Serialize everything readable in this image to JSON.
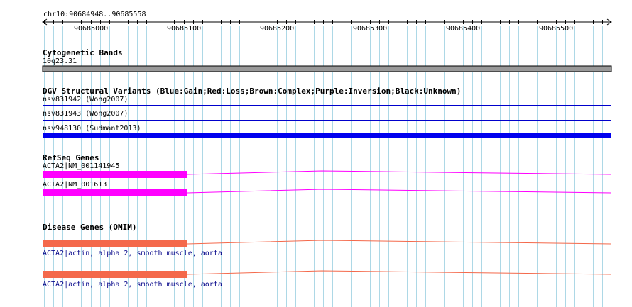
{
  "ruler": {
    "region": "chr10:90684948..90685558",
    "ticks": [
      "90685000",
      "90685100",
      "90685200",
      "90685300",
      "90685400",
      "90685500"
    ]
  },
  "tracks": {
    "cytoband": {
      "title": "Cytogenetic Bands",
      "band": "10q23.31"
    },
    "dgv": {
      "title": "DGV Structural Variants (Blue:Gain;Red:Loss;Brown:Complex;Purple:Inversion;Black:Unknown)",
      "items": [
        {
          "label": "nsv831942 (Wong2007)",
          "color": "#0000cc"
        },
        {
          "label": "nsv831943 (Wong2007)",
          "color": "#0000cc"
        },
        {
          "label": "nsv948130 (Sudmant2013)",
          "color": "#0000ee"
        }
      ]
    },
    "refseq": {
      "title": "RefSeq Genes",
      "items": [
        {
          "label": "ACTA2|NM_001141945",
          "color": "#ff00ff"
        },
        {
          "label": "ACTA2|NM_001613",
          "color": "#ff00ff"
        }
      ]
    },
    "omim": {
      "title": "Disease Genes (OMIM)",
      "items": [
        {
          "label": "ACTA2|actin, alpha 2, smooth muscle, aorta",
          "color": "#f4694b"
        },
        {
          "label": "ACTA2|actin, alpha 2, smooth muscle, aorta",
          "color": "#f4694b"
        }
      ]
    }
  },
  "colors": {
    "grid": "#add8e6",
    "cytoband": "#999999",
    "refseq": "#ff00ff",
    "omim": "#f4694b",
    "dgv_gain": "#0000cc",
    "omim_label": "#0a0a8c"
  }
}
